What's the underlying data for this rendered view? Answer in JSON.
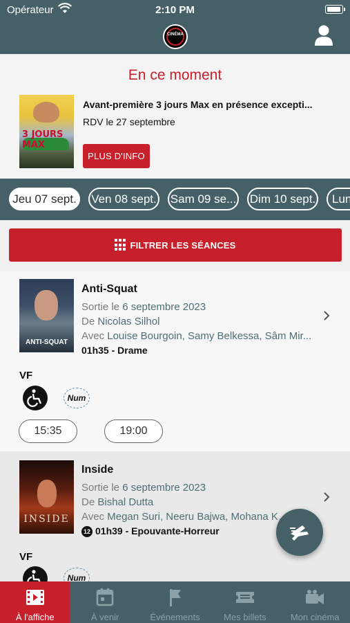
{
  "status": {
    "carrier": "Opérateur",
    "time": "2:10 PM"
  },
  "header": {
    "logo_text": "CINÉMA"
  },
  "banner": {
    "title": "En ce moment",
    "heading": "Avant-première 3 jours Max en présence excepti...",
    "subtitle": "RDV le 27 septembre",
    "button_label": "PLUS D'INFO",
    "poster_title": "3 JOURS MAX"
  },
  "dates": [
    {
      "label": "Jeu 07 sept.",
      "active": true
    },
    {
      "label": "Ven 08 sept.",
      "active": false
    },
    {
      "label": "Sam 09 se...",
      "active": false
    },
    {
      "label": "Dim 10 sept.",
      "active": false
    },
    {
      "label": "Lun",
      "active": false
    }
  ],
  "filter": {
    "label": "FILTRER LES SÉANCES"
  },
  "movies": [
    {
      "title": "Anti-Squat",
      "release_prefix": "Sortie le",
      "release_date": "6 septembre 2023",
      "director_prefix": "De",
      "director": "Nicolas Silhol",
      "cast_prefix": "Avec",
      "cast": "Louise Bourgoin, Samy Belkessa, Sâm Mir...",
      "duration_genre": "01h35 - Drame",
      "version": "VF",
      "num_label": "Num",
      "poster_title": "ANTI-SQUAT",
      "showtimes": [
        "15:35",
        "19:00"
      ]
    },
    {
      "title": "Inside",
      "release_prefix": "Sortie le",
      "release_date": "6 septembre 2023",
      "director_prefix": "De",
      "director": "Bishal Dutta",
      "cast_prefix": "Avec",
      "cast": "Megan Suri, Neeru Bajwa, Mohana Kr...",
      "age_rating": "12",
      "duration_genre": "01h39 - Epouvante-Horreur",
      "version": "VF",
      "num_label": "Num",
      "poster_title": "INSIDE"
    }
  ],
  "tabs": [
    {
      "label": "À l'affiche",
      "icon": "film-icon",
      "active": true
    },
    {
      "label": "À venir",
      "icon": "calendar-icon",
      "active": false
    },
    {
      "label": "Événements",
      "icon": "flag-icon",
      "active": false
    },
    {
      "label": "Mes billets",
      "icon": "ticket-icon",
      "active": false
    },
    {
      "label": "Mon cinéma",
      "icon": "camera-icon",
      "active": false
    }
  ],
  "colors": {
    "header": "#456066",
    "accent": "#c8202a"
  }
}
